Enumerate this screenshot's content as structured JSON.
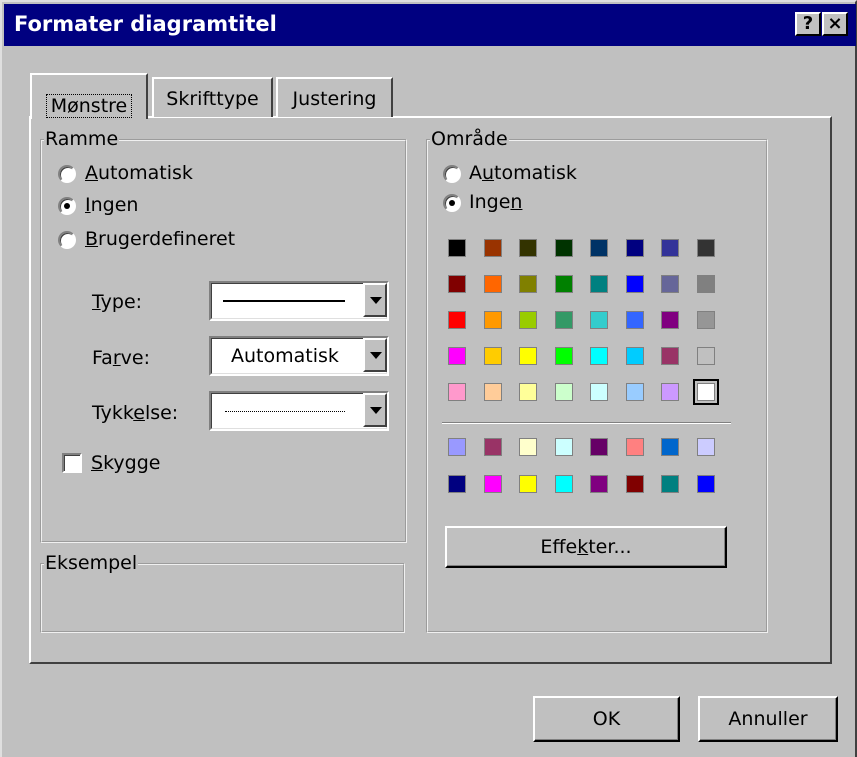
{
  "window": {
    "title": "Formater diagramtitel",
    "help_glyph": "?",
    "close_glyph": "×"
  },
  "tabs": [
    {
      "label": "Mønstre",
      "active": true
    },
    {
      "label": "Skrifttype",
      "active": false
    },
    {
      "label": "Justering",
      "active": false
    }
  ],
  "ramme": {
    "title": "Ramme",
    "options": [
      {
        "pre": "",
        "mn": "A",
        "post": "utomatisk",
        "checked": false
      },
      {
        "pre": "",
        "mn": "I",
        "post": "ngen",
        "checked": true
      },
      {
        "pre": "",
        "mn": "B",
        "post": "rugerdefineret",
        "checked": false
      }
    ],
    "type_label": {
      "pre": "",
      "mn": "T",
      "post": "ype:"
    },
    "farve_label": {
      "pre": "Fa",
      "mn": "r",
      "post": "ve:"
    },
    "farve_value": "Automatisk",
    "tykkelse_label": {
      "pre": "Tykk",
      "mn": "e",
      "post": "lse:"
    },
    "skygge_label": {
      "pre": "",
      "mn": "S",
      "post": "kygge"
    },
    "skygge_checked": false
  },
  "eksempel": {
    "title": "Eksempel"
  },
  "omrade": {
    "title": "Område",
    "options": [
      {
        "pre": "A",
        "mn": "u",
        "post": "tomatisk",
        "checked": false
      },
      {
        "pre": "Inge",
        "mn": "n",
        "post": "",
        "checked": true
      }
    ],
    "palette_top": [
      [
        "#000000",
        "#993300",
        "#333300",
        "#003300",
        "#003366",
        "#000080",
        "#333399",
        "#333333"
      ],
      [
        "#800000",
        "#FF6600",
        "#808000",
        "#008000",
        "#008080",
        "#0000FF",
        "#666699",
        "#808080"
      ],
      [
        "#FF0000",
        "#FF9900",
        "#99CC00",
        "#339966",
        "#33CCCC",
        "#3366FF",
        "#800080",
        "#969696"
      ],
      [
        "#FF00FF",
        "#FFCC00",
        "#FFFF00",
        "#00FF00",
        "#00FFFF",
        "#00CCFF",
        "#993366",
        "#C0C0C0"
      ],
      [
        "#FF99CC",
        "#FFCC99",
        "#FFFF99",
        "#CCFFCC",
        "#CCFFFF",
        "#99CCFF",
        "#CC99FF",
        "#FFFFFF"
      ]
    ],
    "palette_bottom": [
      [
        "#9999FF",
        "#993366",
        "#FFFFCC",
        "#CCFFFF",
        "#660066",
        "#FF8080",
        "#0066CC",
        "#CCCCFF"
      ],
      [
        "#000080",
        "#FF00FF",
        "#FFFF00",
        "#00FFFF",
        "#800080",
        "#800000",
        "#008080",
        "#0000FF"
      ]
    ],
    "selected_swatch": "#FFFFFF",
    "effekter_label": {
      "pre": "Effe",
      "mn": "k",
      "post": "ter..."
    }
  },
  "buttons": {
    "ok": "OK",
    "cancel": "Annuller"
  }
}
